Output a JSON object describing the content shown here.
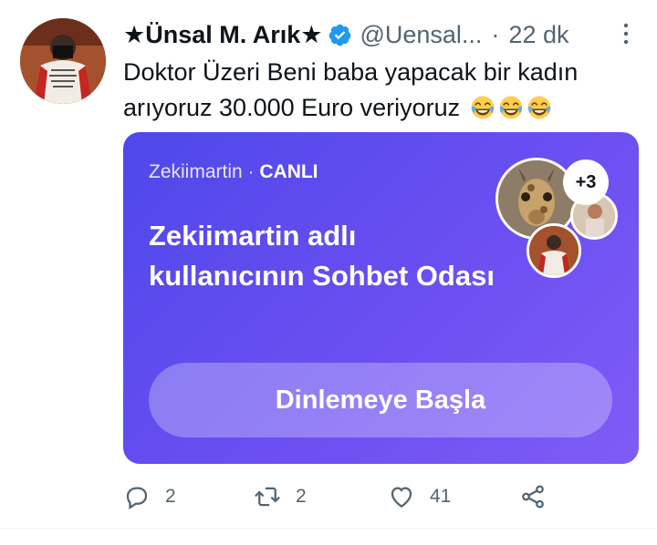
{
  "author": {
    "display_name": "★Ünsal M. Arık★",
    "handle": "@Uensal...",
    "verified": true,
    "avatar_icon": "avatar"
  },
  "meta": {
    "separator": "·",
    "time": "22 dk"
  },
  "tweet": {
    "text": "Doktor Üzeri Beni baba yapacak bir kadın arıyoruz 30.000 Euro veriyoruz",
    "emojis": [
      "face-with-tears-of-joy-icon",
      "face-with-tears-of-joy-icon",
      "face-with-tears-of-joy-icon"
    ]
  },
  "space": {
    "host": "Zekiimartin",
    "separator": " · ",
    "status": "CANLI",
    "title": "Zekiimartin adlı kullanıcının Sohbet Odası",
    "extra_participants": "+3",
    "button_label": "Dinlemeye Başla",
    "colors": {
      "gradient_start": "#4e48ea",
      "gradient_end": "#7f5cf6"
    }
  },
  "actions": {
    "reply_count": "2",
    "retweet_count": "2",
    "like_count": "41"
  },
  "colors": {
    "verified_blue": "#1d9bf0",
    "muted_text": "#536471"
  }
}
